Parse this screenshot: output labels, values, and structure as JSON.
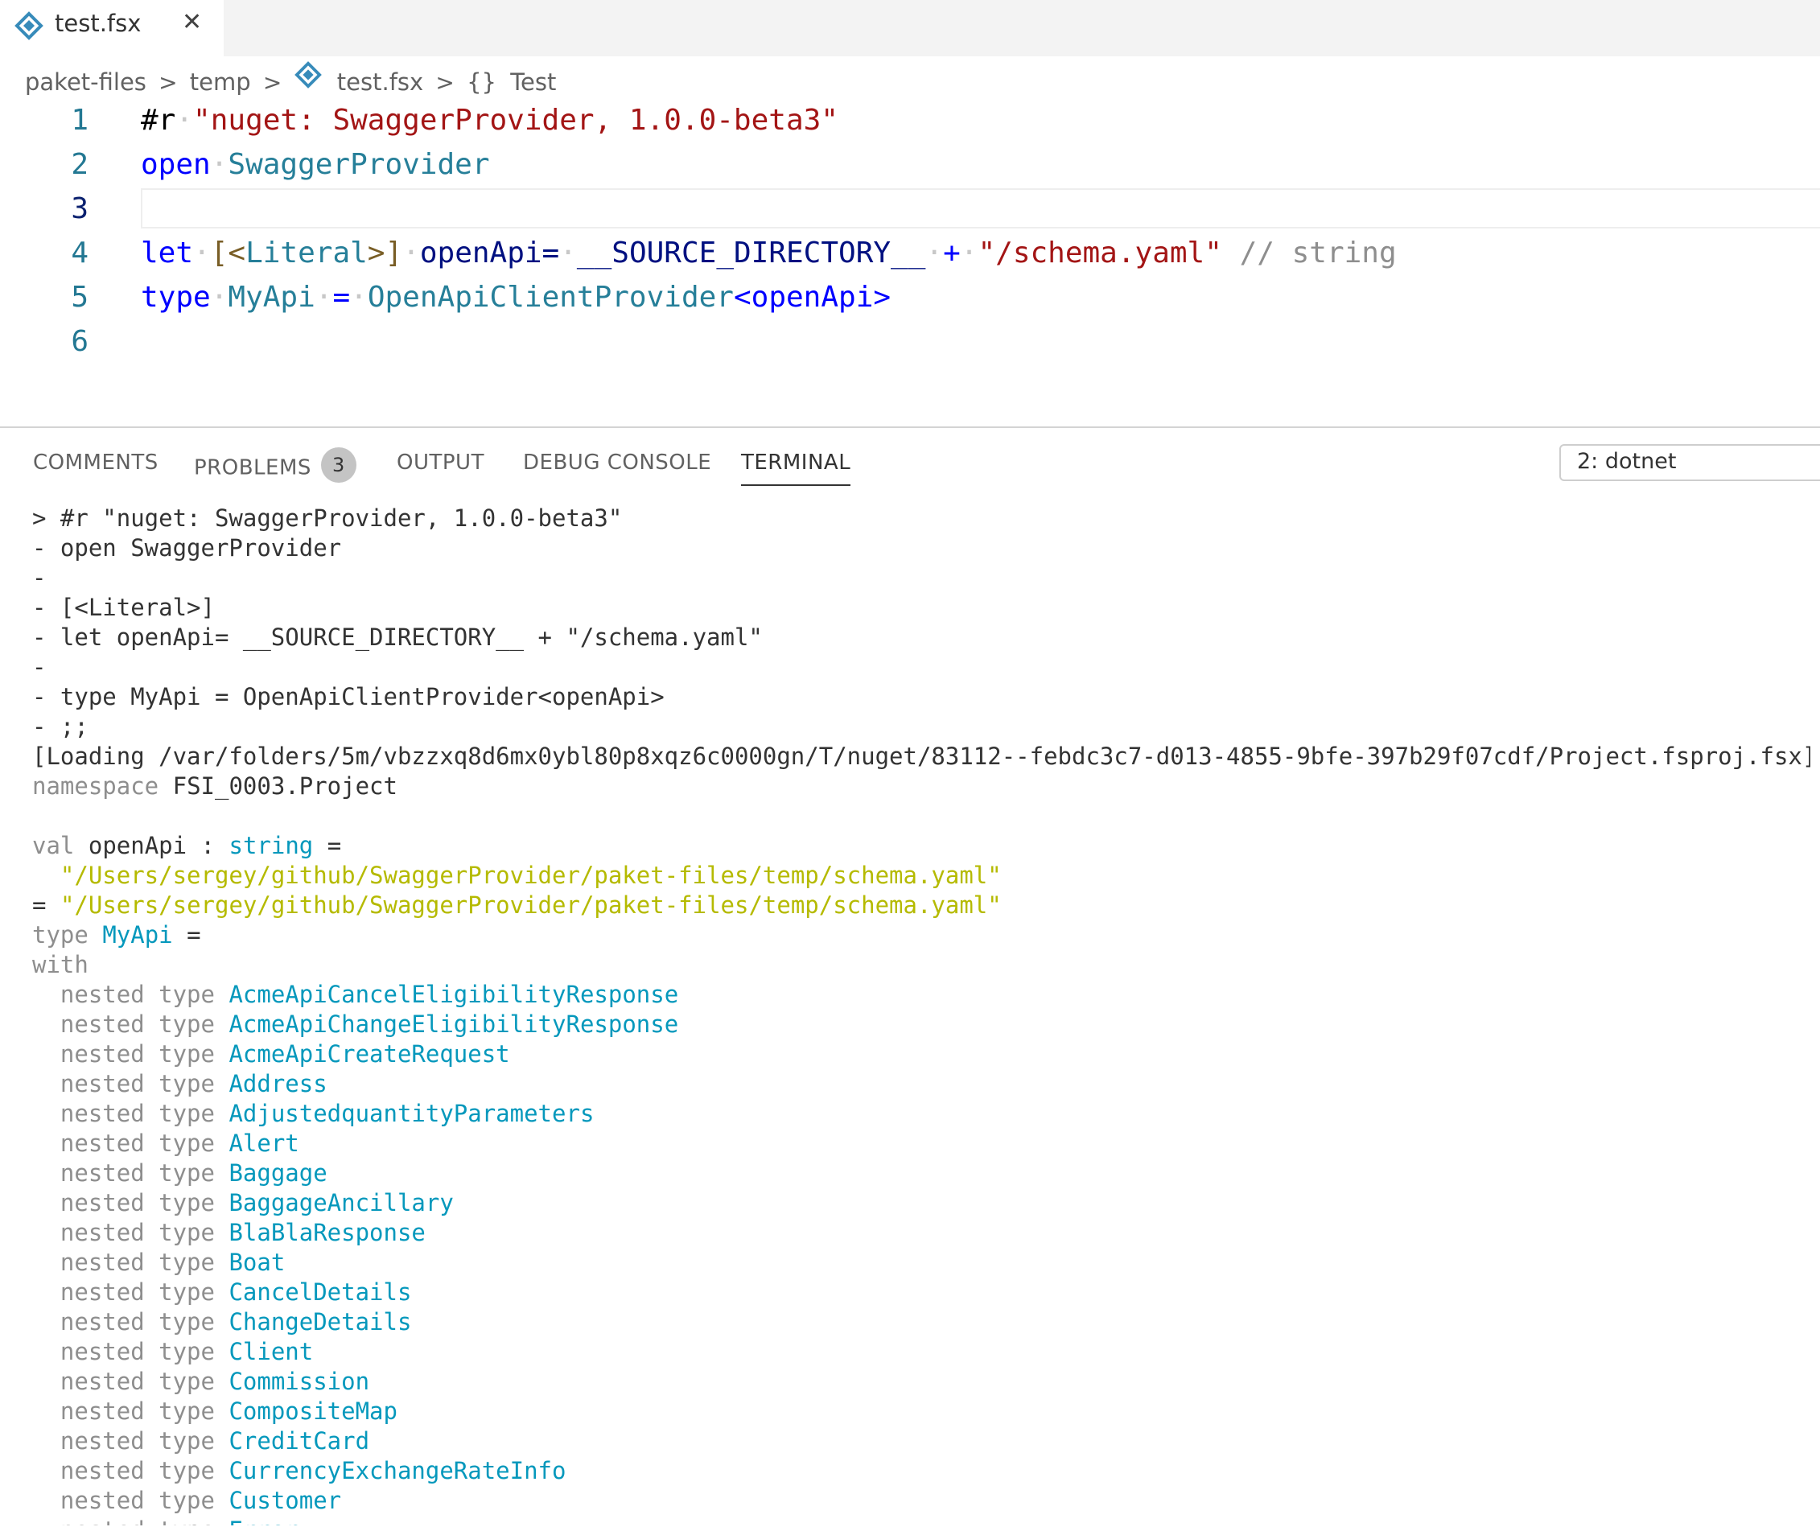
{
  "tabbar": {
    "tab_name": "test.fsx",
    "close_glyph": "✕",
    "file_icon": "fsharp-file-icon"
  },
  "breadcrumb": {
    "items": [
      "paket-files",
      "temp",
      "test.fsx",
      "Test"
    ],
    "separator": ">",
    "namespace_glyph": "{}"
  },
  "editor": {
    "line_numbers": [
      "1",
      "2",
      "3",
      "4",
      "5",
      "6"
    ],
    "line1": {
      "directive": "#r",
      "string": "\"nuget: SwaggerProvider, 1.0.0-beta3\""
    },
    "line2": {
      "keyword": "open",
      "module": "SwaggerProvider"
    },
    "line4": {
      "keyword": "let",
      "attr_open": "[<",
      "attr_name": "Literal",
      "attr_close": ">]",
      "ident": "openApi=",
      "source_dir": "__SOURCE_DIRECTORY__",
      "plus": "+",
      "string": "\"/schema.yaml\"",
      "hint": "// string"
    },
    "line5": {
      "keyword": "type",
      "type_name": "MyApi",
      "equals": "=",
      "provider": "OpenApiClientProvider",
      "generic_arg": "<openApi>"
    }
  },
  "panel": {
    "tabs": [
      "COMMENTS",
      "PROBLEMS",
      "OUTPUT",
      "DEBUG CONSOLE",
      "TERMINAL"
    ],
    "problems_count": "3",
    "active_tab": "TERMINAL",
    "terminal_select": "2: dotnet"
  },
  "terminal": {
    "input_lines": [
      "> #r \"nuget: SwaggerProvider, 1.0.0-beta3\"",
      "- open SwaggerProvider",
      "-",
      "- [<Literal>]",
      "- let openApi= __SOURCE_DIRECTORY__ + \"/schema.yaml\"",
      "-",
      "- type MyApi = OpenApiClientProvider<openApi>",
      "- ;;",
      "[Loading /var/folders/5m/vbzzxq8d6mx0ybl80p8xqz6c0000gn/T/nuget/83112--febdc3c7-d013-4855-9bfe-397b29f07cdf/Project.fsproj.fsx]"
    ],
    "namespace_kw": "namespace",
    "namespace_name": "FSI_0003.Project",
    "val_kw": "val",
    "val_name": "openApi",
    "colon": ":",
    "val_type": "string",
    "equals": "=",
    "val_path": "\"/Users/sergey/github/SwaggerProvider/paket-files/temp/schema.yaml\"",
    "result_prefix": "=",
    "type_kw": "type",
    "type_name": "MyApi",
    "with_kw": "with",
    "nested_prefix": "nested type",
    "nested_types": [
      "AcmeApiCancelEligibilityResponse",
      "AcmeApiChangeEligibilityResponse",
      "AcmeApiCreateRequest",
      "Address",
      "AdjustedquantityParameters",
      "Alert",
      "Baggage",
      "BaggageAncillary",
      "BlaBlaResponse",
      "Boat",
      "CancelDetails",
      "ChangeDetails",
      "Client",
      "Commission",
      "CompositeMap",
      "CreditCard",
      "CurrencyExchangeRateInfo",
      "Customer",
      "Error"
    ]
  },
  "colors": {
    "keyword": "#0000ff",
    "type": "#267f99",
    "string": "#a31515",
    "term_cyan": "#0598bc",
    "term_yellow": "#b5ba00"
  }
}
